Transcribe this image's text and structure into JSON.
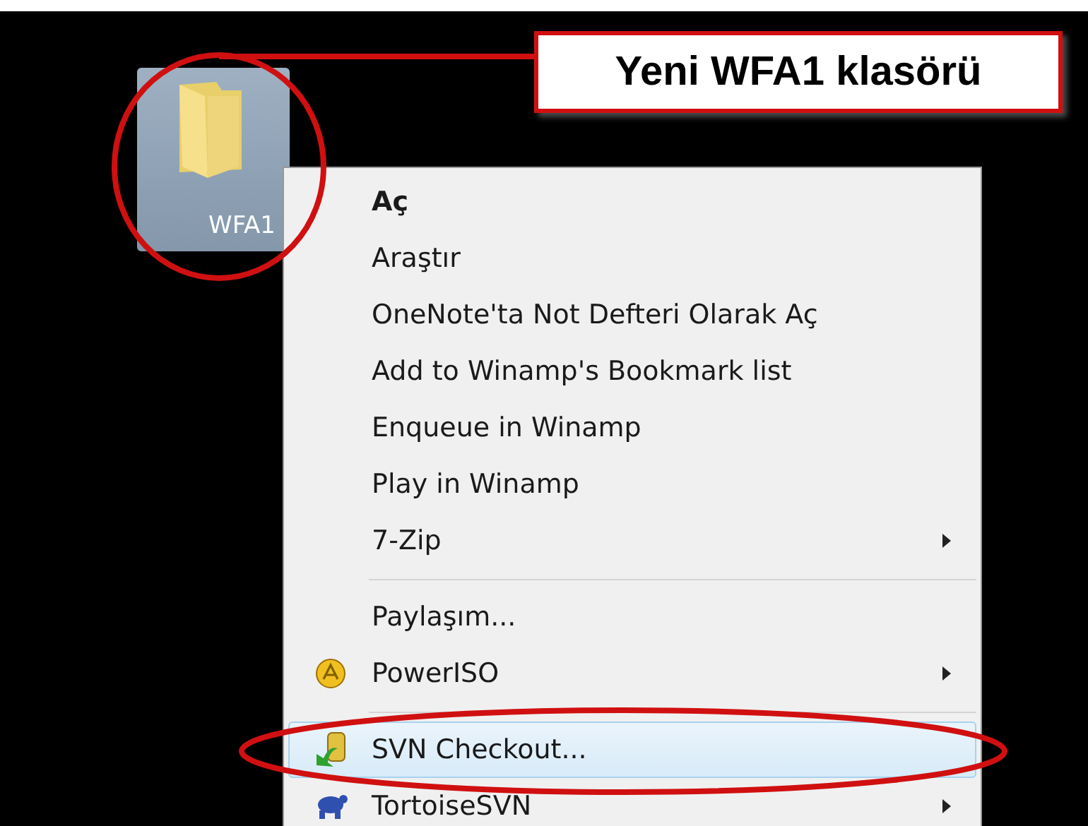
{
  "callout": {
    "text": "Yeni WFA1 klasörü"
  },
  "folder": {
    "name": "WFA1",
    "selected": true
  },
  "menu": {
    "items": [
      {
        "kind": "item",
        "label": "Aç",
        "bold": true,
        "submenu": false,
        "hovered": false
      },
      {
        "kind": "item",
        "label": "Araştır",
        "bold": false,
        "submenu": false,
        "hovered": false
      },
      {
        "kind": "item",
        "label": "OneNote'ta Not Defteri Olarak Aç",
        "bold": false,
        "submenu": false,
        "hovered": false
      },
      {
        "kind": "item",
        "label": "Add to Winamp's Bookmark list",
        "bold": false,
        "submenu": false,
        "hovered": false
      },
      {
        "kind": "item",
        "label": "Enqueue in Winamp",
        "bold": false,
        "submenu": false,
        "hovered": false
      },
      {
        "kind": "item",
        "label": "Play in Winamp",
        "bold": false,
        "submenu": false,
        "hovered": false
      },
      {
        "kind": "item",
        "label": "7-Zip",
        "bold": false,
        "submenu": true,
        "hovered": false
      },
      {
        "kind": "separator"
      },
      {
        "kind": "item",
        "label": "Paylaşım...",
        "bold": false,
        "submenu": false,
        "hovered": false
      },
      {
        "kind": "disc",
        "label": "PowerISO",
        "bold": false,
        "submenu": true,
        "hovered": false
      },
      {
        "kind": "separator"
      },
      {
        "kind": "checkout",
        "label": "SVN Checkout...",
        "bold": false,
        "submenu": false,
        "hovered": true
      },
      {
        "kind": "turtle",
        "label": "TortoiseSVN",
        "bold": false,
        "submenu": true,
        "hovered": false
      }
    ]
  }
}
